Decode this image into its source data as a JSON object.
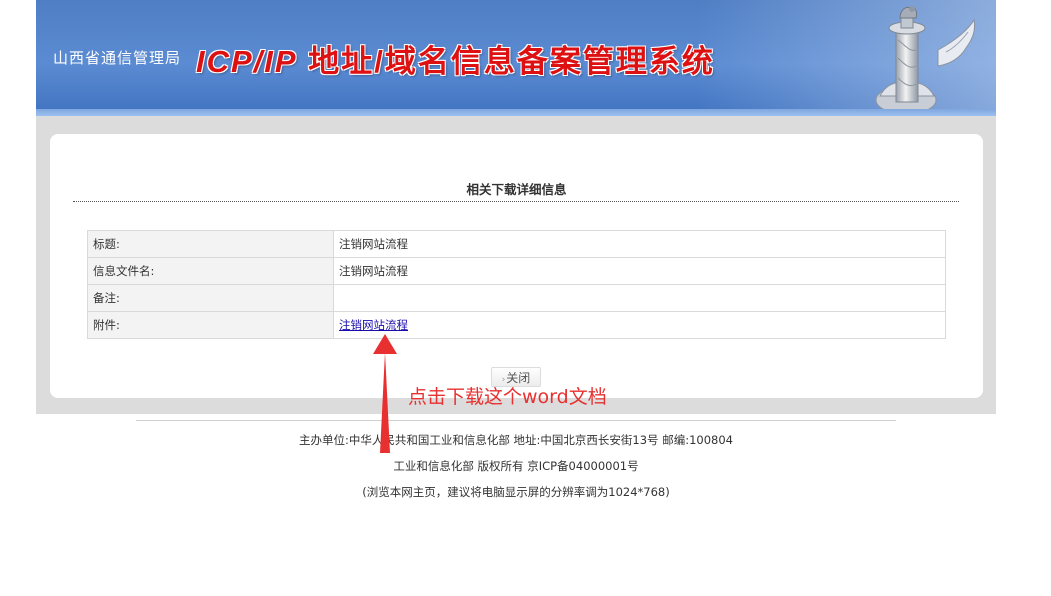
{
  "header": {
    "bureau": "山西省通信管理局",
    "title_latin": "ICP/IP",
    "title_rest": " 地址/域名信息备案管理系统"
  },
  "panel": {
    "title": "相关下载详细信息",
    "rows": [
      {
        "label": "标题:",
        "value": "注销网站流程"
      },
      {
        "label": "信息文件名:",
        "value": "注销网站流程"
      },
      {
        "label": "备注:",
        "value": ""
      },
      {
        "label": "附件:",
        "link": "注销网站流程"
      }
    ],
    "close_button": "关闭"
  },
  "footer": {
    "line1": "主办单位:中华人民共和国工业和信息化部 地址:中国北京西长安街13号 邮编:100804",
    "line2": "工业和信息化部 版权所有 京ICP备04000001号",
    "line3": "(浏览本网主页，建议将电脑显示屏的分辨率调为1024*768)"
  },
  "annotation": {
    "text": "点击下载这个word文档",
    "color": "#e83030"
  },
  "colors": {
    "banner_blue": "#4f7ec4",
    "title_red": "#dd1111",
    "link_blue": "#1a0dab"
  }
}
